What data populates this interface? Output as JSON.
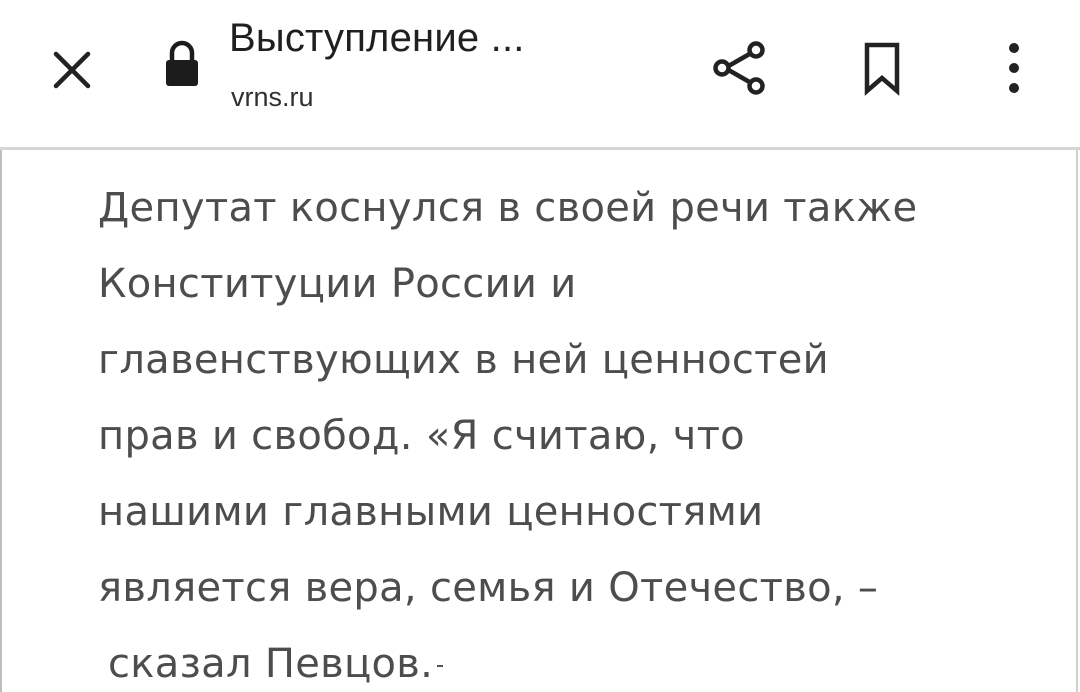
{
  "toolbar": {
    "title": "Выступление ...",
    "url": "vrns.ru",
    "icons": {
      "close": "close-icon",
      "lock": "lock-icon",
      "share": "share-icon",
      "bookmark": "bookmark-icon",
      "menu": "more-vert-icon"
    }
  },
  "article": {
    "lines": [
      "Депутат коснулся в своей речи также",
      "Конституции России и",
      "главенствующих в ней ценностей",
      "прав и свобод. «Я считаю, что",
      "нашими главными ценностями",
      "является вера, семья и Отечество, –",
      "сказал Певцов."
    ]
  },
  "colors": {
    "text": "#4d4d4d",
    "toolbar_text": "#202020",
    "divider": "#d6d6d6",
    "background": "#ffffff"
  }
}
